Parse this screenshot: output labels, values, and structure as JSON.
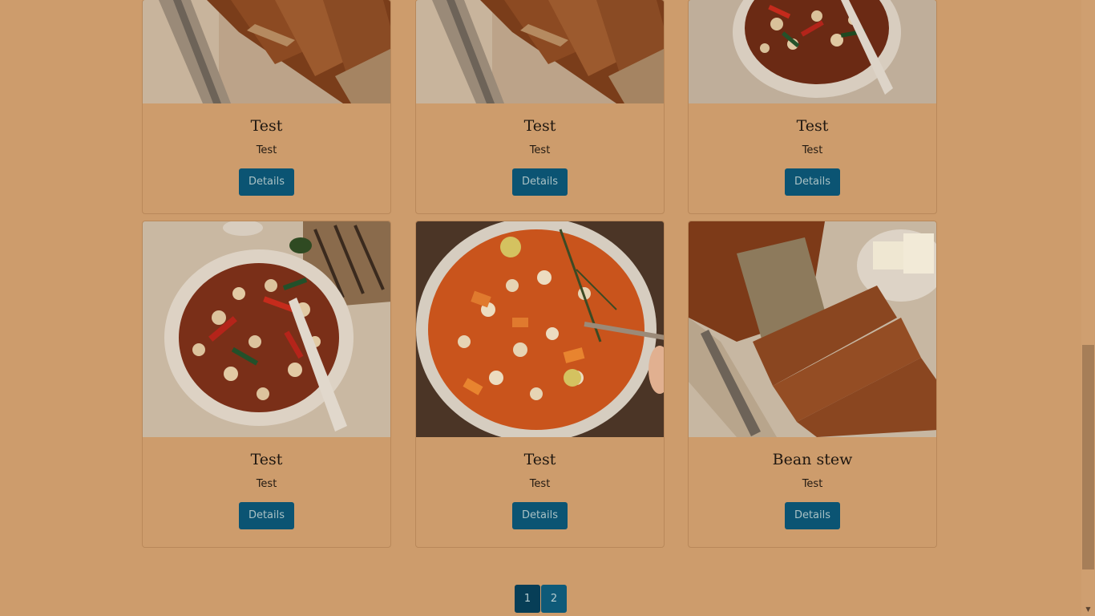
{
  "cards": [
    {
      "title": "Test",
      "text": "Test",
      "button": "Details",
      "image": "banana-bread-photo"
    },
    {
      "title": "Test",
      "text": "Test",
      "button": "Details",
      "image": "banana-bread-photo"
    },
    {
      "title": "Test",
      "text": "Test",
      "button": "Details",
      "image": "bean-pepper-stew-photo"
    },
    {
      "title": "Test",
      "text": "Test",
      "button": "Details",
      "image": "bean-pepper-stew-photo"
    },
    {
      "title": "Test",
      "text": "Test",
      "button": "Details",
      "image": "bean-carrot-soup-photo"
    },
    {
      "title": "Bean stew",
      "text": "Test",
      "button": "Details",
      "image": "banana-bread-photo"
    }
  ],
  "pagination": {
    "pages": [
      "1",
      "2"
    ],
    "active": "1"
  },
  "colors": {
    "page_background": "#cd9c6c",
    "button": "#0b5473",
    "active_page": "#073e57"
  }
}
